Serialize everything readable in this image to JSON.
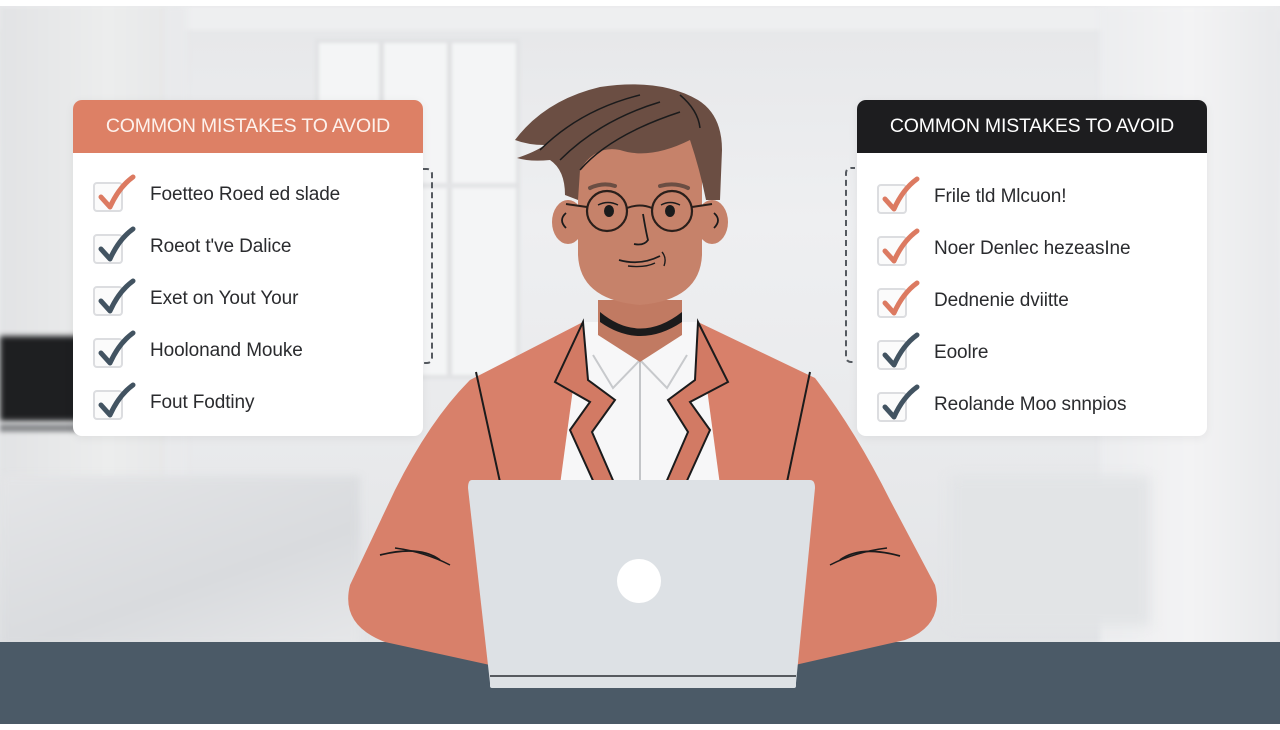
{
  "colors": {
    "accent_orange": "#dd8065",
    "header_dark": "#1d1d1f",
    "check_orange": "#dc7a61",
    "check_slate": "#425361",
    "desk": "#4b5a67",
    "jacket": "#d8806a",
    "skin": "#c6826a",
    "hair": "#6b4e43",
    "laptop": "#dde1e5"
  },
  "left_card": {
    "title": "COMMON MISTAKES TO AVOID",
    "items": [
      {
        "label": "Foetteo Roed ed slade",
        "check_color": "orange",
        "checked": true
      },
      {
        "label": "Roeot t've Dalice",
        "check_color": "slate",
        "checked": true
      },
      {
        "label": "Exet on Yout Your",
        "check_color": "slate",
        "checked": true
      },
      {
        "label": "Hoolonand Mouke",
        "check_color": "slate",
        "checked": true
      },
      {
        "label": "Fout Fodtiny",
        "check_color": "slate",
        "checked": true
      }
    ]
  },
  "right_card": {
    "title": "COMMON MISTAKES TO AVOID",
    "items": [
      {
        "label": "Frile tld Mlcuon!",
        "check_color": "orange",
        "checked": true
      },
      {
        "label": "Noer Denlec hezeasIne",
        "check_color": "orange",
        "checked": true
      },
      {
        "label": "Dednenie dviitte",
        "check_color": "orange",
        "checked": true
      },
      {
        "label": "Eoolre",
        "check_color": "slate",
        "checked": true
      },
      {
        "label": "Reolande Moo snnpios",
        "check_color": "slate",
        "checked": true
      }
    ]
  },
  "illustration": {
    "subject": "person with glasses working on laptop",
    "icons": [
      "laptop-icon",
      "checkmark-icon"
    ]
  }
}
